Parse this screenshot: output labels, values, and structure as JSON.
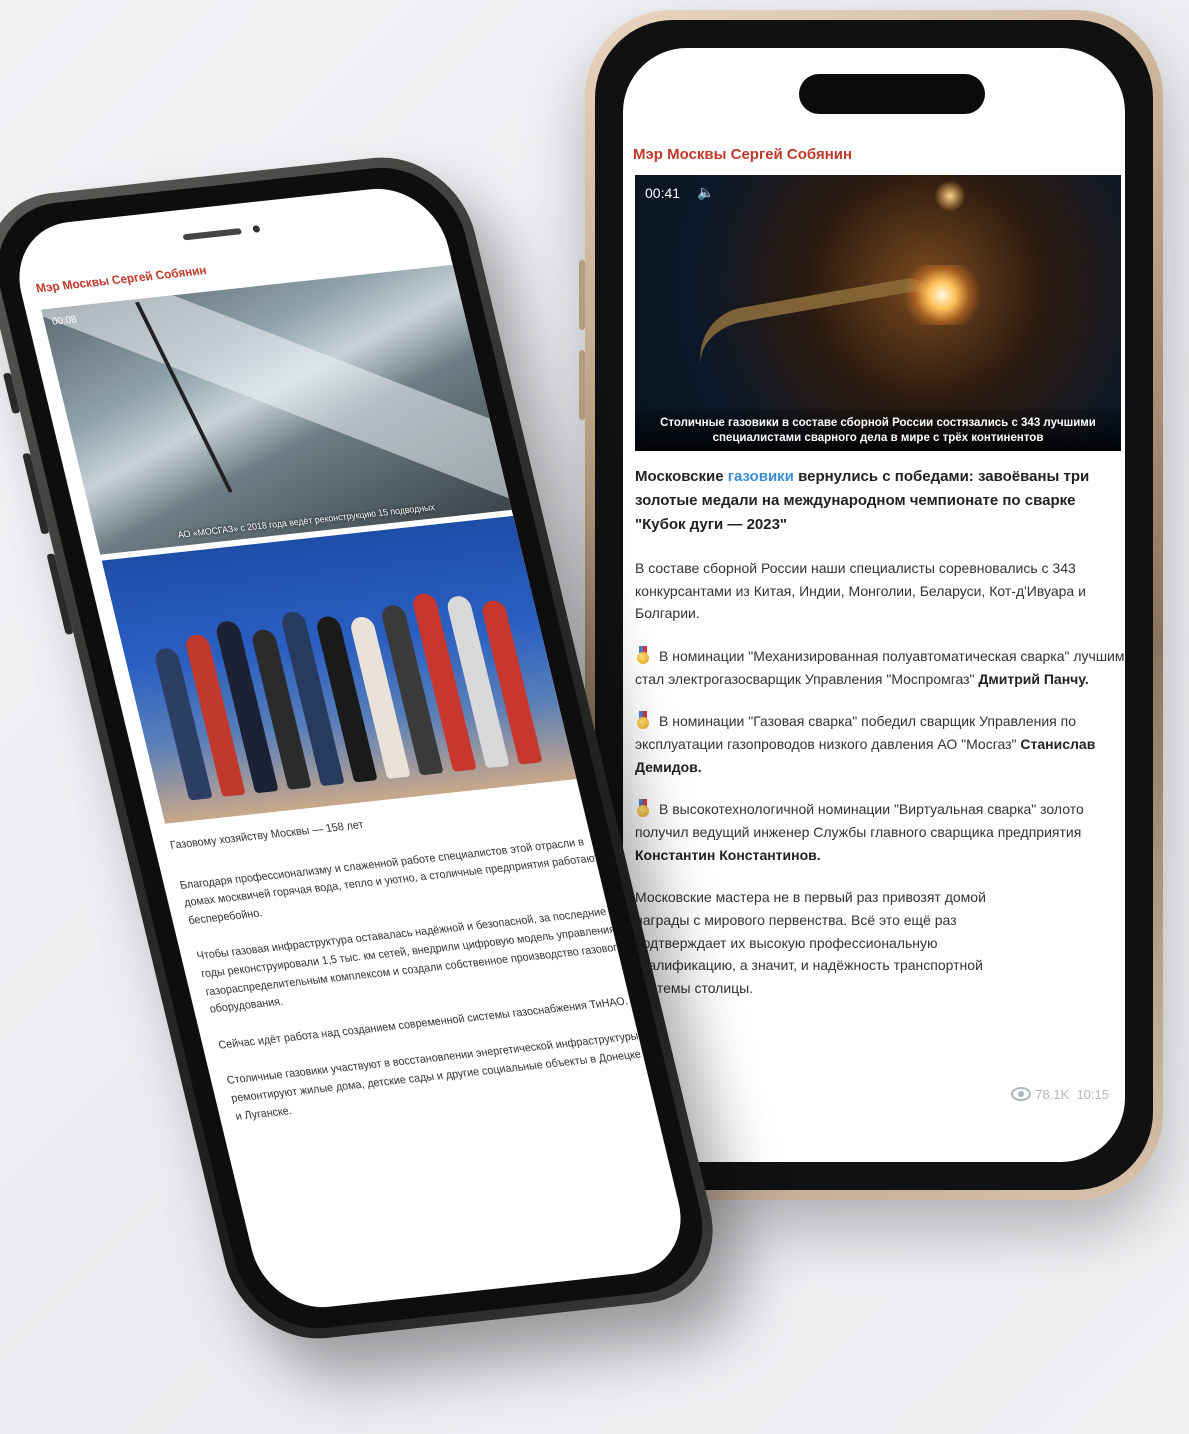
{
  "right_phone": {
    "channel": "Мэр Москвы Сергей Собянин",
    "video": {
      "time": "00:41",
      "sound_icon": "speaker-icon",
      "caption": "Столичные газовики в составе сборной России состязались с 343 лучшими специалистами сварного дела в мире с трёх континентов"
    },
    "headline_start": "Московские ",
    "headline_link": "газовики",
    "headline_end": " вернулись с победами: завоёваны три золотые медали на международном чемпионате по сварке \"Кубок дуги — 2023\"",
    "intro": "В составе сборной России наши специалисты соревновались с 343 конкурсантами из Китая, Индии, Монголии, Беларуси, Кот-д'Ивуара и Болгарии.",
    "items": [
      {
        "text": "В номинации \"Механизированная полуавтоматическая сварка\" лучшим стал электрогазосварщик Управления \"Моспромгаз\" ",
        "bold": "Дмитрий Панчу."
      },
      {
        "text": "В номинации \"Газовая сварка\" победил сварщик Управления по эксплуатации газопроводов низкого давления АО \"Мосгаз\" ",
        "bold": "Станислав Демидов."
      },
      {
        "text": "В высокотехнологичной номинации \"Виртуальная сварка\" золото получил ведущий инженер Службы главного сварщика предприятия ",
        "bold": "Константин Константинов."
      }
    ],
    "outro": "Московские мастера не в первый раз привозят домой награды с мирового первенства. Всё это ещё раз подтверждает их высокую профессиональную квалификацию, а значит, и надёжность транспортной системы столицы.",
    "views": "78.1K",
    "time_posted": "10:15"
  },
  "left_phone": {
    "channel": "Мэр Москвы Сергей Собянин",
    "video_time": "00:08",
    "video_caption": "АО «МОСГАЗ» с 2018 года ведёт реконструкцию 15 подводных",
    "photo_caption": "Газовому хозяйству Москвы — 158 лет",
    "paragraphs": [
      "Благодаря профессионализму и слаженной работе специалистов этой отрасли в домах москвичей горячая вода, тепло и уютно, а столичные предприятия работают бесперебойно.",
      "Чтобы газовая инфраструктура оставалась надёжной и безопасной, за последние годы реконструировали 1,5 тыс. км сетей, внедрили цифровую модель управления газораспределительным комплексом и создали собственное производство газового оборудования.",
      "Сейчас идёт работа над созданием современной системы газоснабжения ТиНАО.",
      "Столичные газовики участвуют в восстановлении энергетической инфраструктуры, ремонтируют жилые дома, детские сады и другие социальные объекты в Донецке и Луганске."
    ]
  }
}
